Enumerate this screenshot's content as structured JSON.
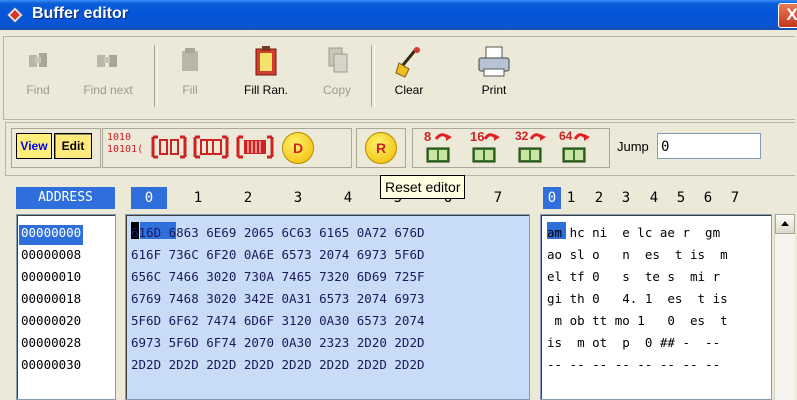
{
  "window": {
    "title": "Buffer editor",
    "close_glyph": "X"
  },
  "toolbar": {
    "find": "Find",
    "find_next": "Find next",
    "fill": "Fill",
    "fill_random": "Fill Ran.",
    "copy": "Copy",
    "clear": "Clear",
    "print": "Print"
  },
  "toolbar2": {
    "view": "View",
    "edit": "Edit",
    "binary_top": "1010",
    "binary_bottom": "10101(",
    "d_label": "D",
    "r_label": "R",
    "width8": "8",
    "width16": "16",
    "width32": "32",
    "width64": "64",
    "jump_label": "Jump",
    "jump_value": "0"
  },
  "tooltip": "Reset editor",
  "headers": {
    "address": "ADDRESS",
    "hex_columns": [
      "0",
      "1",
      "2",
      "3",
      "4",
      "5",
      "6",
      "7"
    ],
    "ascii_columns": [
      "0",
      "1",
      "2",
      "3",
      "4",
      "5",
      "6",
      "7"
    ]
  },
  "rows": [
    {
      "address": "00000000",
      "hex": "616D 6863 6E69 2065 6C63 6165 0A72 676D",
      "ascii": "am hc ni  e lc ae r  gm"
    },
    {
      "address": "00000008",
      "hex": "616F 736C 6F20 0A6E 6573 2074 6973 5F6D",
      "ascii": "ao sl o   n  es  t is  m"
    },
    {
      "address": "00000010",
      "hex": "656C 7466 3020 730A 7465 7320 6D69 725F",
      "ascii": "el tf 0   s  te s  mi r"
    },
    {
      "address": "00000018",
      "hex": "6769 7468 3020 342E 0A31 6573 2074 6973",
      "ascii": "gi th 0   4. 1  es  t is"
    },
    {
      "address": "00000020",
      "hex": "5F6D 6F62 7474 6D6F 3120 0A30 6573 2074",
      "ascii": " m ob tt mo 1   0  es  t"
    },
    {
      "address": "00000028",
      "hex": "6973 5F6D 6F74 2070 0A30 2323 2D20 2D2D",
      "ascii": "is  m ot  p  0 ## -  --"
    },
    {
      "address": "00000030",
      "hex": "2D2D 2D2D 2D2D 2D2D 2D2D 2D2D 2D2D 2D2D",
      "ascii": "-- -- -- -- -- -- -- --"
    }
  ]
}
